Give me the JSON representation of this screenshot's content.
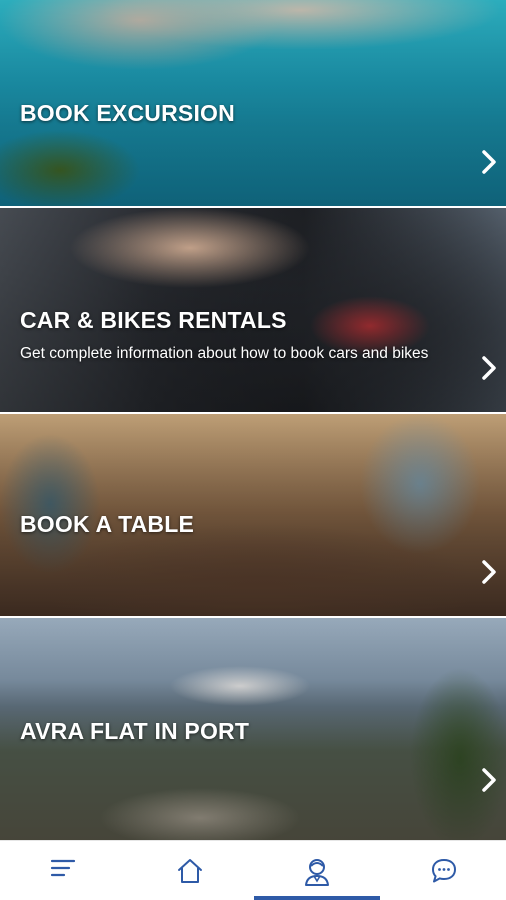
{
  "cards": [
    {
      "title": "BOOK EXCURSION",
      "subtitle": "",
      "icon": "chevron-right-icon"
    },
    {
      "title": "CAR & BIKES RENTALS",
      "subtitle": "Get complete information about how to book cars and bikes",
      "icon": "chevron-right-icon"
    },
    {
      "title": "BOOK A TABLE",
      "subtitle": "",
      "icon": "chevron-right-icon"
    },
    {
      "title": "AVRA FLAT IN PORT",
      "subtitle": "",
      "icon": "chevron-right-icon"
    }
  ],
  "bottom_nav": {
    "items": [
      {
        "icon": "menu-icon"
      },
      {
        "icon": "home-icon"
      },
      {
        "icon": "concierge-icon",
        "selected": true
      },
      {
        "icon": "chat-icon"
      }
    ],
    "accent_color": "#2e5aa7"
  }
}
